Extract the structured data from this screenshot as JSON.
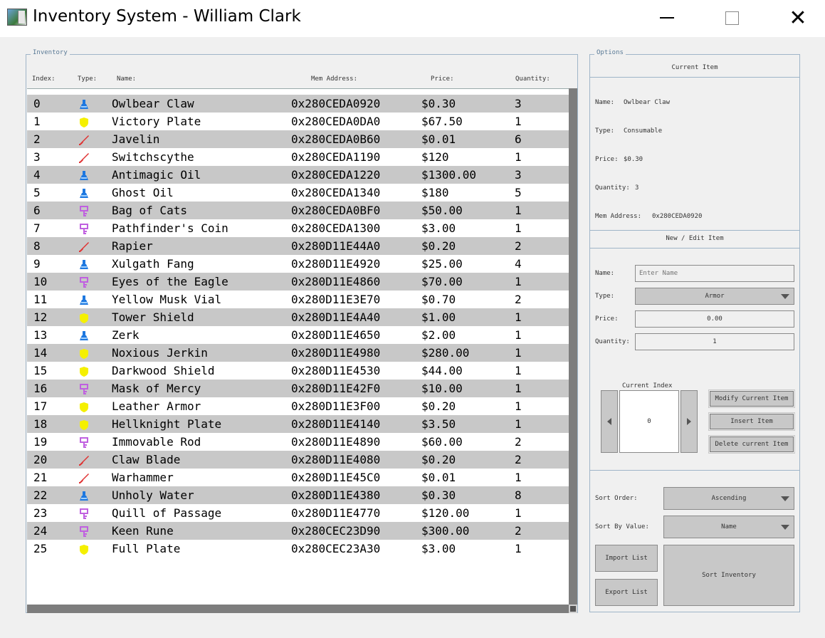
{
  "window": {
    "title": "Inventory System - William Clark",
    "minimize": "",
    "maximize": "",
    "close": "✕"
  },
  "inventory": {
    "group_title": "Inventory",
    "headers": {
      "index": "Index:",
      "type": "Type:",
      "name": "Name:",
      "address": "Mem Address:",
      "price": "Price:",
      "quantity": "Quantity:"
    },
    "rows": [
      {
        "index": "0",
        "type": "potion",
        "name": "Owlbear Claw",
        "address": "0x280CEDA0920",
        "price": "$0.30",
        "qty": "3"
      },
      {
        "index": "1",
        "type": "shield",
        "name": "Victory Plate",
        "address": "0x280CEDA0DA0",
        "price": "$67.50",
        "qty": "1"
      },
      {
        "index": "2",
        "type": "sword",
        "name": "Javelin",
        "address": "0x280CEDA0B60",
        "price": "$0.01",
        "qty": "6"
      },
      {
        "index": "3",
        "type": "sword",
        "name": "Switchscythe",
        "address": "0x280CEDA1190",
        "price": "$120",
        "qty": "1"
      },
      {
        "index": "4",
        "type": "potion",
        "name": "Antimagic Oil",
        "address": "0x280CEDA1220",
        "price": "$1300.00",
        "qty": "3"
      },
      {
        "index": "5",
        "type": "potion",
        "name": "Ghost Oil",
        "address": "0x280CEDA1340",
        "price": "$180",
        "qty": "5"
      },
      {
        "index": "6",
        "type": "key",
        "name": "Bag of Cats",
        "address": "0x280CEDA0BF0",
        "price": "$50.00",
        "qty": "1"
      },
      {
        "index": "7",
        "type": "key",
        "name": "Pathfinder's Coin",
        "address": "0x280CEDA1300",
        "price": "$3.00",
        "qty": "1"
      },
      {
        "index": "8",
        "type": "sword",
        "name": "Rapier",
        "address": "0x280D11E44A0",
        "price": "$0.20",
        "qty": "2"
      },
      {
        "index": "9",
        "type": "potion",
        "name": "Xulgath Fang",
        "address": "0x280D11E4920",
        "price": "$25.00",
        "qty": "4"
      },
      {
        "index": "10",
        "type": "key",
        "name": "Eyes of the Eagle",
        "address": "0x280D11E4860",
        "price": "$70.00",
        "qty": "1"
      },
      {
        "index": "11",
        "type": "potion",
        "name": "Yellow Musk Vial",
        "address": "0x280D11E3E70",
        "price": "$0.70",
        "qty": "2"
      },
      {
        "index": "12",
        "type": "shield",
        "name": "Tower Shield",
        "address": "0x280D11E4A40",
        "price": "$1.00",
        "qty": "1"
      },
      {
        "index": "13",
        "type": "potion",
        "name": "Zerk",
        "address": "0x280D11E4650",
        "price": "$2.00",
        "qty": "1"
      },
      {
        "index": "14",
        "type": "shield",
        "name": "Noxious Jerkin",
        "address": "0x280D11E4980",
        "price": "$280.00",
        "qty": "1"
      },
      {
        "index": "15",
        "type": "shield",
        "name": "Darkwood Shield",
        "address": "0x280D11E4530",
        "price": "$44.00",
        "qty": "1"
      },
      {
        "index": "16",
        "type": "key",
        "name": "Mask of Mercy",
        "address": "0x280D11E42F0",
        "price": "$10.00",
        "qty": "1"
      },
      {
        "index": "17",
        "type": "shield",
        "name": "Leather Armor",
        "address": "0x280D11E3F00",
        "price": "$0.20",
        "qty": "1"
      },
      {
        "index": "18",
        "type": "shield",
        "name": "Hellknight Plate",
        "address": "0x280D11E4140",
        "price": "$3.50",
        "qty": "1"
      },
      {
        "index": "19",
        "type": "key",
        "name": "Immovable Rod",
        "address": "0x280D11E4890",
        "price": "$60.00",
        "qty": "2"
      },
      {
        "index": "20",
        "type": "sword",
        "name": "Claw Blade",
        "address": "0x280D11E4080",
        "price": "$0.20",
        "qty": "2"
      },
      {
        "index": "21",
        "type": "sword",
        "name": "Warhammer",
        "address": "0x280D11E45C0",
        "price": "$0.01",
        "qty": "1"
      },
      {
        "index": "22",
        "type": "potion",
        "name": "Unholy Water",
        "address": "0x280D11E4380",
        "price": "$0.30",
        "qty": "8"
      },
      {
        "index": "23",
        "type": "key",
        "name": "Quill of Passage",
        "address": "0x280D11E4770",
        "price": "$120.00",
        "qty": "1"
      },
      {
        "index": "24",
        "type": "key",
        "name": "Keen Rune",
        "address": "0x280CEC23D90",
        "price": "$300.00",
        "qty": "2"
      },
      {
        "index": "25",
        "type": "shield",
        "name": "Full Plate",
        "address": "0x280CEC23A30",
        "price": "$3.00",
        "qty": "1"
      }
    ]
  },
  "icons": {
    "potion": {
      "name": "potion-icon",
      "color": "#1e78e0"
    },
    "shield": {
      "name": "shield-icon",
      "color": "#f5f000"
    },
    "sword": {
      "name": "sword-icon",
      "color": "#e03030"
    },
    "key": {
      "name": "key-icon",
      "color": "#c060e0"
    }
  },
  "options": {
    "group_title": "Options",
    "current_item": {
      "heading": "Current Item",
      "name_label": "Name:",
      "name_value": "Owlbear Claw",
      "type_label": "Type:",
      "type_value": "Consumable",
      "price_label": "Price:",
      "price_value": "$0.30",
      "quantity_label": "Quantity:",
      "quantity_value": "3",
      "address_label": "Mem Address:",
      "address_value": "0x280CEDA0920"
    },
    "edit_item": {
      "heading": "New / Edit Item",
      "name_label": "Name:",
      "name_placeholder": "Enter Name",
      "type_label": "Type:",
      "type_value": "Armor",
      "price_label": "Price:",
      "price_value": "0.00",
      "quantity_label": "Quantity:",
      "quantity_value": "1",
      "current_index_label": "Current Index",
      "current_index_value": "0",
      "modify_button": "Modify Current Item",
      "insert_button": "Insert  Item",
      "delete_button": "Delete current Item"
    },
    "sort": {
      "order_label": "Sort Order:",
      "order_value": "Ascending",
      "by_label": "Sort By Value:",
      "by_value": "Name",
      "import_button": "Import List",
      "export_button": "Export List",
      "sort_button": "Sort Inventory"
    }
  }
}
